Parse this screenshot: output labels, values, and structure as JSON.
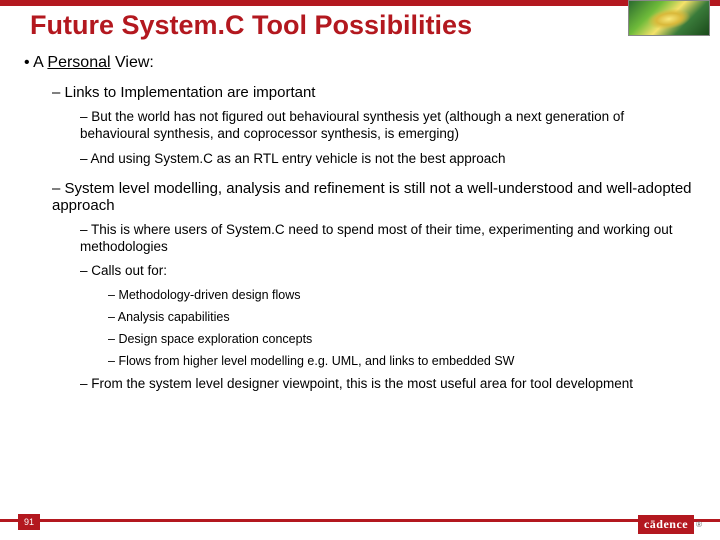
{
  "title": "Future System.C Tool Possibilities",
  "intro": {
    "prefix": "A ",
    "underlined": "Personal",
    "suffix": " View:"
  },
  "p1": "Links to Implementation are important",
  "p1a": "But the world has not figured out behavioural synthesis yet (although a next generation of behavioural synthesis, and coprocessor synthesis, is emerging)",
  "p1b": "And using System.C as an RTL entry vehicle is not the best approach",
  "p2": "System level modelling, analysis and refinement is still not a well-understood and well-adopted approach",
  "p2a": "This is where users of System.C need to spend most of their time, experimenting and working out methodologies",
  "p2b": "Calls out for:",
  "p2b1": "Methodology-driven design flows",
  "p2b2": "Analysis capabilities",
  "p2b3": "Design space exploration concepts",
  "p2b4": "Flows from higher level modelling e.g. UML, and links to embedded SW",
  "p2c": "From the system level designer viewpoint, this is the most useful area for tool development",
  "page_number": "91",
  "logo_text": "cādence"
}
